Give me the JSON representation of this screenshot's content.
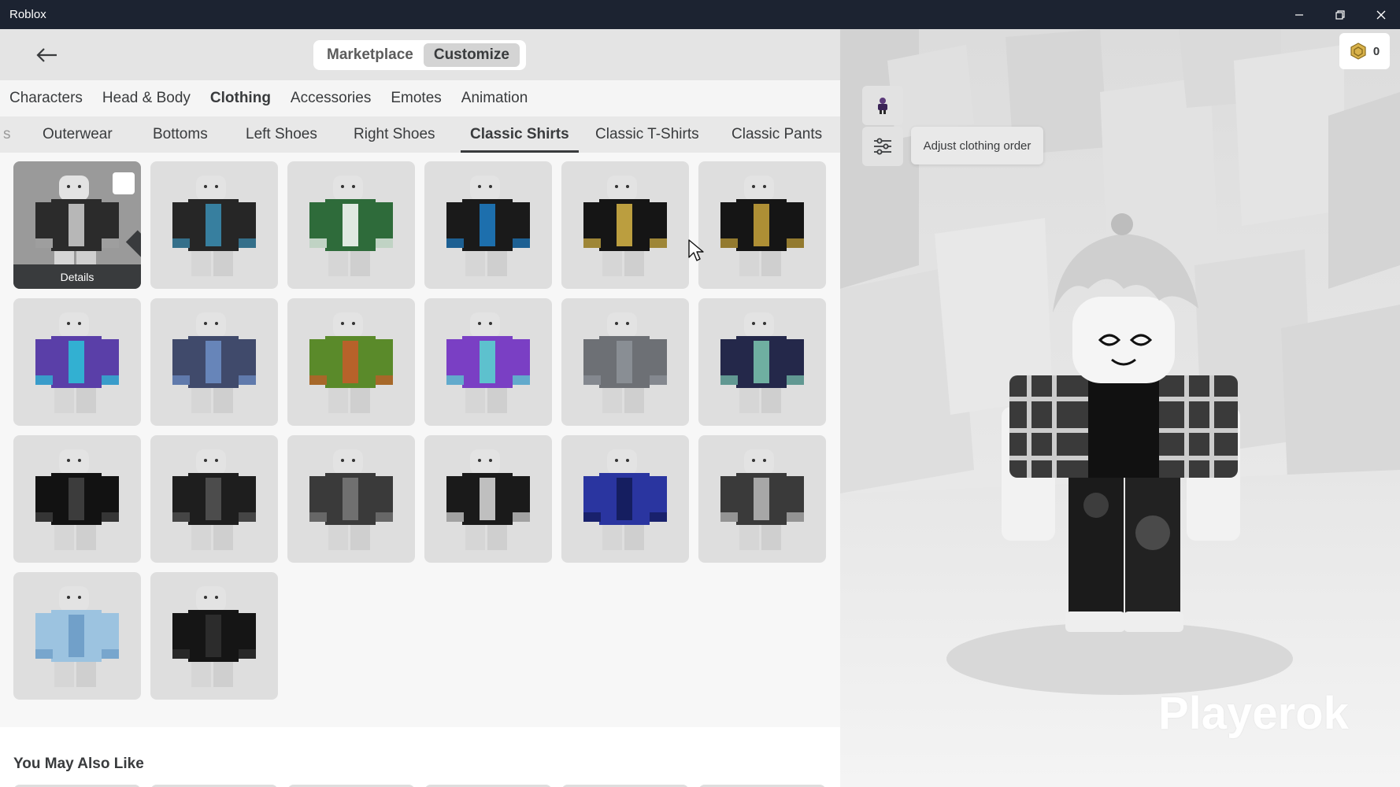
{
  "window": {
    "title": "Roblox",
    "controls": [
      "minimize-icon",
      "restore-icon",
      "close-icon"
    ]
  },
  "header": {
    "back_icon": "arrow-left-icon",
    "mode_tabs": [
      {
        "label": "Marketplace",
        "active": false
      },
      {
        "label": "Customize",
        "active": true
      }
    ]
  },
  "category_tabs": [
    {
      "label": "Characters",
      "active": false
    },
    {
      "label": "Head & Body",
      "active": false
    },
    {
      "label": "Clothing",
      "active": true
    },
    {
      "label": "Accessories",
      "active": false
    },
    {
      "label": "Emotes",
      "active": false
    },
    {
      "label": "Animation",
      "active": false
    }
  ],
  "sub_tabs": [
    {
      "label": "s",
      "active": false
    },
    {
      "label": "Outerwear",
      "active": false
    },
    {
      "label": "Bottoms",
      "active": false
    },
    {
      "label": "Left Shoes",
      "active": false
    },
    {
      "label": "Right Shoes",
      "active": false
    },
    {
      "label": "Classic Shirts",
      "active": true
    },
    {
      "label": "Classic T-Shirts",
      "active": false
    },
    {
      "label": "Classic Pants",
      "active": false
    }
  ],
  "items": {
    "details_label": "Details",
    "tiles": [
      {
        "torso": "#2b2b2b",
        "accent": "#d0d0d0",
        "selected": true
      },
      {
        "torso": "#262626",
        "accent": "#3b8fb5",
        "selected": false
      },
      {
        "torso": "#2e6b3a",
        "accent": "#ffffff",
        "selected": false
      },
      {
        "torso": "#1a1a1a",
        "accent": "#1f7fc8",
        "selected": false
      },
      {
        "torso": "#151515",
        "accent": "#d8b646",
        "selected": false
      },
      {
        "torso": "#151515",
        "accent": "#c9a53b",
        "selected": false
      },
      {
        "torso": "#5a3fa8",
        "accent": "#2bc4d9",
        "selected": false
      },
      {
        "torso": "#404a6b",
        "accent": "#6e8fc7",
        "selected": false
      },
      {
        "torso": "#5a8a2a",
        "accent": "#c85a2a",
        "selected": false
      },
      {
        "torso": "#7a3fc4",
        "accent": "#58d8d0",
        "selected": false
      },
      {
        "torso": "#6d7075",
        "accent": "#8e939a",
        "selected": false
      },
      {
        "torso": "#24284a",
        "accent": "#7cc7b0",
        "selected": false
      },
      {
        "torso": "#121212",
        "accent": "#444444",
        "selected": false
      },
      {
        "torso": "#1e1e1e",
        "accent": "#555555",
        "selected": false
      },
      {
        "torso": "#3a3a3a",
        "accent": "#7a7a7a",
        "selected": false
      },
      {
        "torso": "#1a1a1a",
        "accent": "#dddddd",
        "selected": false
      },
      {
        "torso": "#2a35a0",
        "accent": "#121a55",
        "selected": false
      },
      {
        "torso": "#3a3a3a",
        "accent": "#bbbbbb",
        "selected": false
      },
      {
        "torso": "#9cc3e0",
        "accent": "#6a9ac4",
        "selected": false
      },
      {
        "torso": "#151515",
        "accent": "#303030",
        "selected": false
      }
    ]
  },
  "recommendations": {
    "title": "You May Also Like"
  },
  "viewport": {
    "robux_icon": "robux-coin-icon",
    "robux_balance": "0",
    "avatar_button_icon": "avatar-thumbnail-icon",
    "adjust_button_icon": "sliders-icon",
    "tooltip": "Adjust clothing order",
    "player_name": "Playerok"
  },
  "colors": {
    "titlebar_bg": "#1c2331",
    "text_primary": "#393b3d",
    "tile_bg": "#dedede",
    "tile_selected_bg": "#9a9a9a"
  }
}
